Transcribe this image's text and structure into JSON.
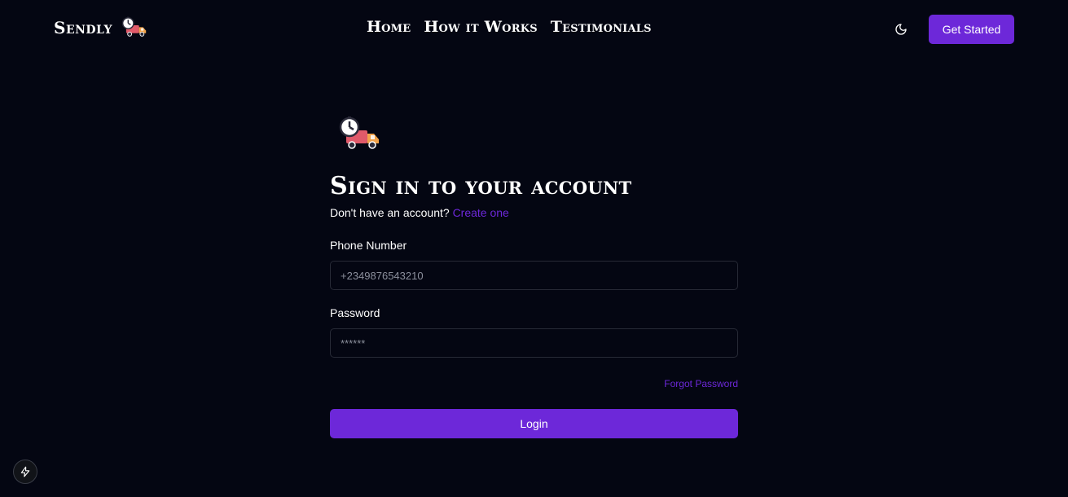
{
  "header": {
    "brand": "Sendly",
    "brand_icon": "delivery-truck-clock-icon",
    "nav": [
      {
        "label": "Home"
      },
      {
        "label": "How it Works"
      },
      {
        "label": "Testimonials"
      }
    ],
    "theme_icon": "moon-icon",
    "cta_label": "Get Started"
  },
  "form": {
    "icon": "delivery-truck-clock-icon",
    "title": "Sign in to your account",
    "subtitle_text": "Don't have an account?",
    "subtitle_link": "Create one",
    "phone_label": "Phone Number",
    "phone_placeholder": "+2349876543210",
    "password_label": "Password",
    "password_placeholder": "******",
    "forgot_label": "Forgot Password",
    "login_label": "Login"
  },
  "badge_icon": "lightning-bolt-icon",
  "colors": {
    "background": "#040612",
    "accent": "#6d28d9",
    "input_border": "#272a36"
  }
}
